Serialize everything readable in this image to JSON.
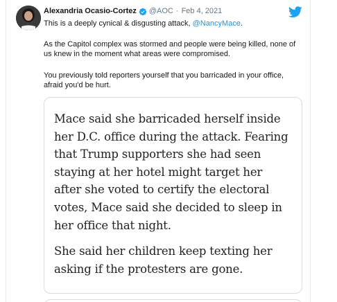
{
  "tweet": {
    "display_name": "Alexandria Ocasio-Cortez",
    "handle": "@AOC",
    "separator": "·",
    "date": "Feb 4, 2021",
    "line1_text": "This is a deeply cynical & disgusting attack, ",
    "line1_mention": "@NancyMace",
    "line1_end": ".",
    "para2": "As the Capitol complex was stormed and people were being killed, none of us knew in the moment what areas were compromised.",
    "para3": "You previously told reporters yourself that you barricaded in your office, afraid you'd be hurt."
  },
  "quote": {
    "paragraph1": "Mace said she barricaded herself inside her D.C. office during the attack. Fearing that Trump supporters she had seen staying at her hotel might target her after she voted to certify the electoral votes, Mace said she decided to sleep in her office that night.",
    "paragraph2": "She said her children keep texting her asking if the protesters are gone."
  },
  "icons": {
    "verified": "verified-badge-icon",
    "brand": "twitter-bird-icon"
  },
  "colors": {
    "link": "#1b95e0",
    "brand": "#1da1f2",
    "muted": "#657786"
  }
}
